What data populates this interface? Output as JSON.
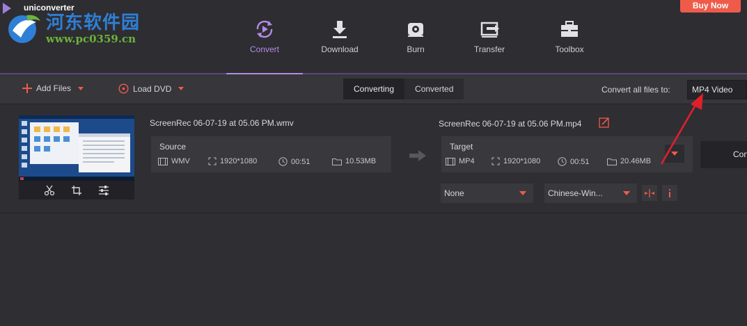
{
  "app": {
    "name": "uniconverter"
  },
  "watermark": {
    "title": "河东软件园",
    "url": "www.pc0359.cn"
  },
  "header": {
    "buy_label": "Buy Now"
  },
  "nav": {
    "tabs": [
      {
        "label": "Convert",
        "icon": "convert-icon",
        "active": true
      },
      {
        "label": "Download",
        "icon": "download-icon",
        "active": false
      },
      {
        "label": "Burn",
        "icon": "disc-icon",
        "active": false
      },
      {
        "label": "Transfer",
        "icon": "transfer-icon",
        "active": false
      },
      {
        "label": "Toolbox",
        "icon": "toolbox-icon",
        "active": false
      }
    ]
  },
  "toolbar": {
    "add_files": "Add Files",
    "load_dvd": "Load DVD",
    "segments": [
      {
        "label": "Converting",
        "active": true
      },
      {
        "label": "Converted",
        "active": false
      }
    ],
    "convert_all_label": "Convert all files to:",
    "convert_all_value": "MP4 Video"
  },
  "file": {
    "source_name": "ScreenRec 06-07-19 at 05.06 PM.wmv",
    "target_name": "ScreenRec 06-07-19 at 05.06 PM.mp4",
    "source": {
      "title": "Source",
      "format": "WMV",
      "resolution": "1920*1080",
      "duration": "00:51",
      "size": "10.53MB"
    },
    "target": {
      "title": "Target",
      "format": "MP4",
      "resolution": "1920*1080",
      "duration": "00:51",
      "size": "20.46MB"
    },
    "subtitle_value": "None",
    "audio_value": "Chinese-Win...",
    "convert_label": "Convert"
  },
  "colors": {
    "accent": "#b489e8",
    "buy": "#ef5b4a",
    "caret": "#ef5b4a",
    "arrow": "#e0202a"
  }
}
